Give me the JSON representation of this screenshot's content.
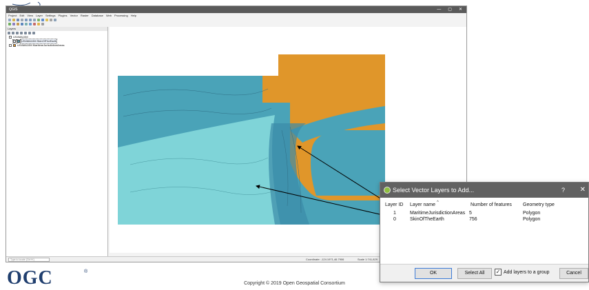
{
  "window": {
    "title": "QGIS",
    "controls": [
      "—",
      "▢",
      "✕"
    ]
  },
  "menus": [
    "Project",
    "Edit",
    "View",
    "Layer",
    "Settings",
    "Plugins",
    "Vector",
    "Raster",
    "Database",
    "Web",
    "Processing",
    "Help"
  ],
  "layers_panel": {
    "title": "Layers",
    "group_name": "US4MA10M",
    "layers": [
      {
        "name": "US4MA10M SkinOfTheEarth",
        "color": "#4aa3b8"
      },
      {
        "name": "US4MA10M MaritimeJurisdictionAreas",
        "color": "#e0962a"
      }
    ]
  },
  "statusbar": {
    "locator_placeholder": "Type to locate (Ctrl+K)",
    "coordinate": "Coordinate: -124.1971,46.7906",
    "scale": "Scale 1:741,829"
  },
  "map": {
    "land_color": "#e0962a",
    "ocean_dark": "#4aa3b8",
    "ocean_light": "#7fd4d8",
    "deep_color": "#3a8aa8"
  },
  "dialog": {
    "title": "Select Vector Layers to Add...",
    "help": "?",
    "close": "✕",
    "columns": {
      "id": "Layer ID",
      "name": "Layer name",
      "features": "Number of features",
      "geometry": "Geometry type"
    },
    "rows": [
      {
        "id": "1",
        "name": "MaritimeJurisdictionAreas",
        "features": "5",
        "geometry": "Polygon"
      },
      {
        "id": "0",
        "name": "SkinOfTheEarth",
        "features": "756",
        "geometry": "Polygon"
      }
    ],
    "ok_label": "OK",
    "select_all_label": "Select All",
    "add_to_group_label": "Add layers to a group",
    "add_to_group_checked": "✓",
    "cancel_label": "Cancel"
  },
  "footer": {
    "logo": "OGC",
    "reg": "®",
    "copyright": "Copyright © 2019 Open Geospatial Consortium"
  }
}
